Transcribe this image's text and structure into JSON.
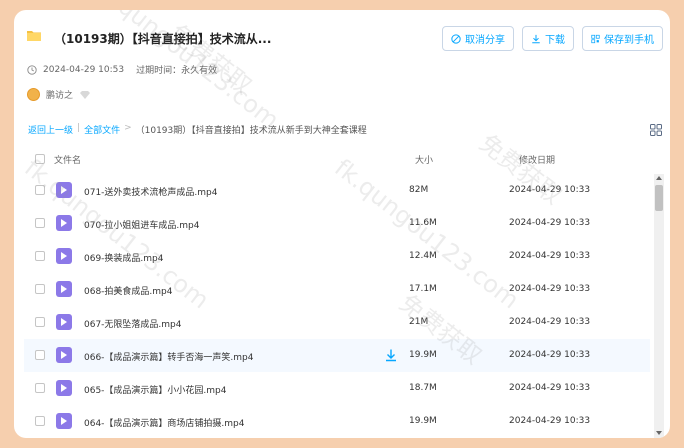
{
  "header": {
    "title": "（10193期）【抖音直接拍】技术流从...",
    "buttons": {
      "cancel_share": "取消分享",
      "download": "下载",
      "save_to_phone": "保存到手机"
    },
    "date": "2024-04-29 10:53",
    "expire": "过期时间：永久有效",
    "sharer": "鹏访之"
  },
  "breadcrumb": {
    "back": "返回上一级",
    "all_files": "全部文件",
    "current": "（10193期）【抖音直接拍】技术流从新手到大神全套课程"
  },
  "table": {
    "headers": {
      "name": "文件名",
      "size": "大小",
      "date": "修改日期"
    },
    "rows": [
      {
        "name": "071-送外卖技术流枪声成品.mp4",
        "size": "82M",
        "date": "2024-04-29 10:33"
      },
      {
        "name": "070-拉小姐姐进车成品.mp4",
        "size": "11.6M",
        "date": "2024-04-29 10:33"
      },
      {
        "name": "069-换装成品.mp4",
        "size": "12.4M",
        "date": "2024-04-29 10:33"
      },
      {
        "name": "068-拍美食成品.mp4",
        "size": "17.1M",
        "date": "2024-04-29 10:33"
      },
      {
        "name": "067-无限坠落成品.mp4",
        "size": "21M",
        "date": "2024-04-29 10:33"
      },
      {
        "name": "066-【成品演示篇】转手否海一声笑.mp4",
        "size": "19.9M",
        "date": "2024-04-29 10:33"
      },
      {
        "name": "065-【成品演示篇】小小花园.mp4",
        "size": "18.7M",
        "date": "2024-04-29 10:33"
      },
      {
        "name": "064-【成品演示篇】商场店铺拍摄.mp4",
        "size": "19.9M",
        "date": "2024-04-29 10:33"
      }
    ]
  },
  "watermarks": [
    "免费获取",
    "fk.qungou123.com"
  ],
  "colors": {
    "accent": "#06a7ff",
    "background": "#f6cfae",
    "video_icon": "#8c79e8"
  }
}
